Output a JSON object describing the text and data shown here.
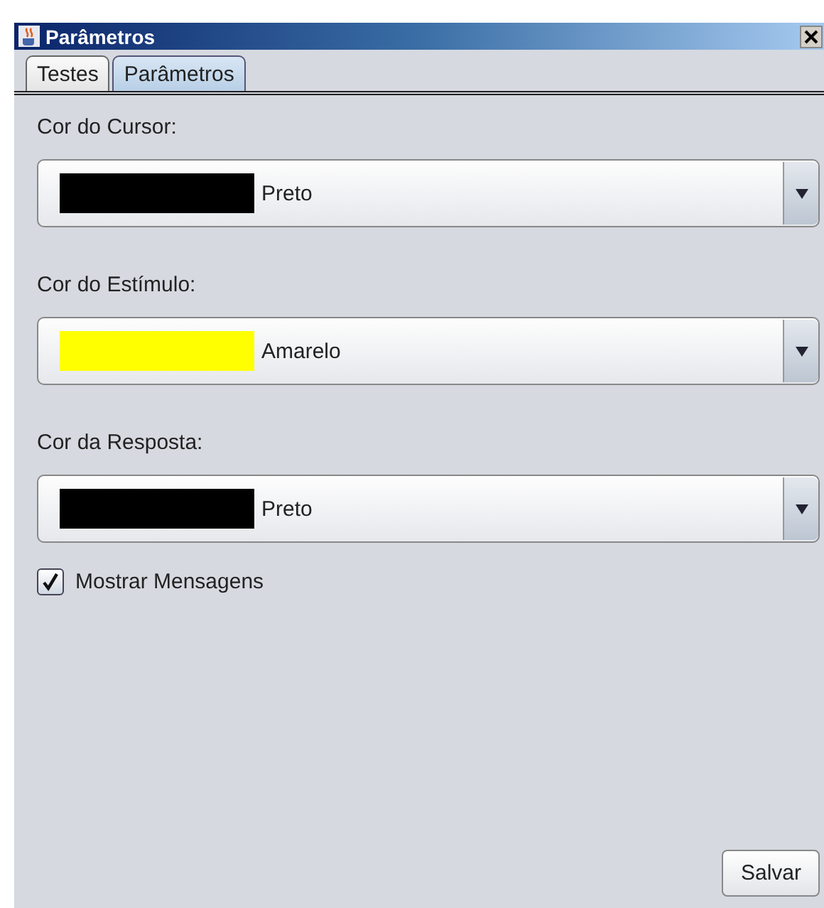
{
  "window": {
    "title": "Parâmetros"
  },
  "tabs": [
    {
      "label": "Testes",
      "selected": false
    },
    {
      "label": "Parâmetros",
      "selected": true
    }
  ],
  "fields": [
    {
      "label": "Cor do Cursor:",
      "value": "Preto",
      "color": "#000000"
    },
    {
      "label": "Cor do Estímulo:",
      "value": "Amarelo",
      "color": "#ffff00"
    },
    {
      "label": "Cor da Resposta:",
      "value": "Preto",
      "color": "#000000"
    }
  ],
  "checkbox": {
    "label": "Mostrar Mensagens",
    "checked": true
  },
  "buttons": [
    "Salvar"
  ]
}
